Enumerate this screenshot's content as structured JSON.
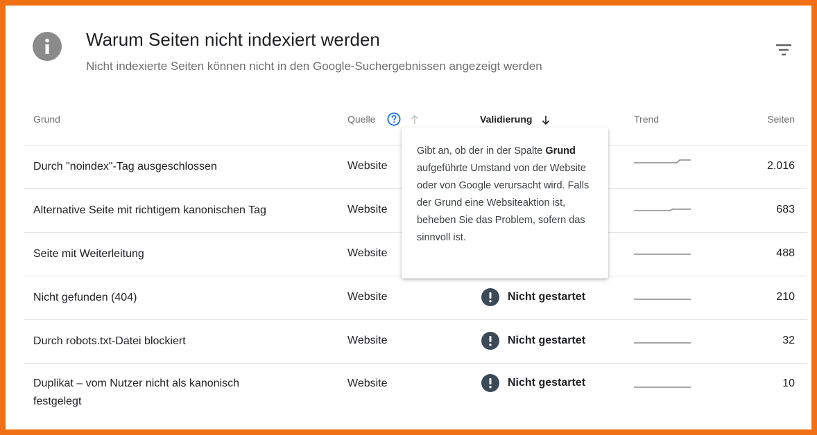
{
  "header": {
    "title": "Warum Seiten nicht indexiert werden",
    "subtitle": "Nicht indexierte Seiten können nicht in den Google-Suchergebnissen angezeigt werden",
    "info_icon": "info-icon",
    "filter_icon": "filter-icon"
  },
  "table": {
    "columns": {
      "reason": "Grund",
      "source": "Quelle",
      "validation": "Validierung",
      "trend": "Trend",
      "pages": "Seiten"
    },
    "rows": [
      {
        "reason": "Durch \"noindex\"-Tag ausgeschlossen",
        "source": "Website",
        "validation": "",
        "pages": "2.016"
      },
      {
        "reason": "Alternative Seite mit richtigem kanonischen Tag",
        "source": "Website",
        "validation": "",
        "pages": "683"
      },
      {
        "reason": "Seite mit Weiterleitung",
        "source": "Website",
        "validation": "",
        "pages": "488"
      },
      {
        "reason": "Nicht gefunden (404)",
        "source": "Website",
        "validation": "Nicht gestartet",
        "pages": "210"
      },
      {
        "reason": "Durch robots.txt-Datei blockiert",
        "source": "Website",
        "validation": "Nicht gestartet",
        "pages": "32"
      },
      {
        "reason": "Duplikat – vom Nutzer nicht als kanonisch festgelegt",
        "source": "Website",
        "validation": "Nicht gestartet",
        "pages": "10"
      }
    ]
  },
  "tooltip": {
    "text_before": "Gibt an, ob der in der Spalte ",
    "bold": "Grund",
    "text_after": " aufgeführte Umstand von der Website oder von Google verursacht wird. Falls der Grund eine Websiteaktion ist, beheben Sie das Problem, sofern das sinnvoll ist."
  },
  "colors": {
    "frame": "#f07013",
    "status_icon": "#3c4a57",
    "help_icon": "#1a73e8"
  }
}
